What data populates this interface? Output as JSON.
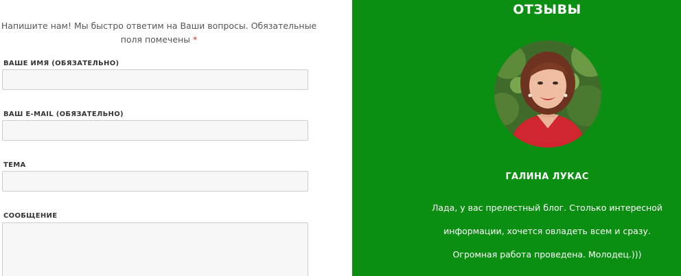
{
  "contact_form": {
    "intro_text": "Напишите нам! Мы быстро ответим на Ваши вопросы. Обязательные поля помечены",
    "required_mark": "*",
    "fields": {
      "name": {
        "label": "ВАШЕ ИМЯ (ОБЯЗАТЕЛЬНО)",
        "value": ""
      },
      "email": {
        "label": "ВАШ E-MAIL (ОБЯЗАТЕЛЬНО)",
        "value": ""
      },
      "topic": {
        "label": "ТЕМА",
        "value": ""
      },
      "message": {
        "label": "СООБЩЕНИЕ",
        "value": ""
      }
    }
  },
  "reviews": {
    "title": "ОТЗЫВЫ",
    "background_color": "#0b8f12",
    "reviewer": {
      "name": "ГАЛИНА ЛУКАС",
      "text_lines": [
        "Лада, у вас прелестный блог. Столько интересной",
        "информации, хочется овладеть всем и сразу.",
        "Огромная работа проведена. Молодец.)))"
      ]
    }
  }
}
